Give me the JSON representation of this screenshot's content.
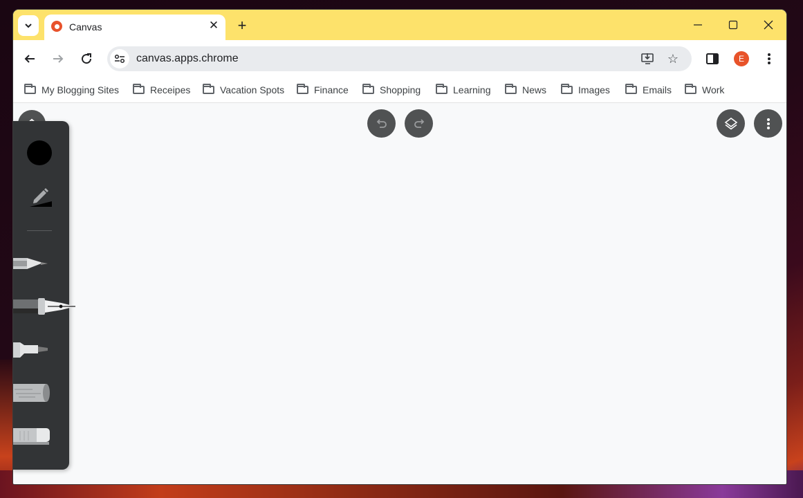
{
  "browser": {
    "tab": {
      "title": "Canvas",
      "favicon": "canvas-app-icon"
    },
    "new_tab_label": "+",
    "window_controls": {
      "minimize": "minimize-icon",
      "maximize": "maximize-icon",
      "close": "close-icon"
    },
    "url": "canvas.apps.chrome",
    "profile_initial": "E",
    "accent_color": "#fde26b",
    "profile_color": "#e8532a"
  },
  "bookmarks": [
    {
      "label": "My Blogging Sites"
    },
    {
      "label": "Receipes"
    },
    {
      "label": "Vacation Spots"
    },
    {
      "label": "Finance"
    },
    {
      "label": "Shopping"
    },
    {
      "label": "Learning"
    },
    {
      "label": "News"
    },
    {
      "label": "Images"
    },
    {
      "label": "Emails"
    },
    {
      "label": "Work"
    }
  ],
  "canvas_app": {
    "top_controls": {
      "undo": "undo-icon",
      "redo": "redo-icon",
      "layers": "layers-icon",
      "menu": "more-vert-icon"
    },
    "palette": {
      "selected_color": "#000000",
      "tools": [
        "pencil",
        "pen",
        "marker",
        "chalk",
        "eraser"
      ],
      "selected_tool": "pen"
    }
  }
}
